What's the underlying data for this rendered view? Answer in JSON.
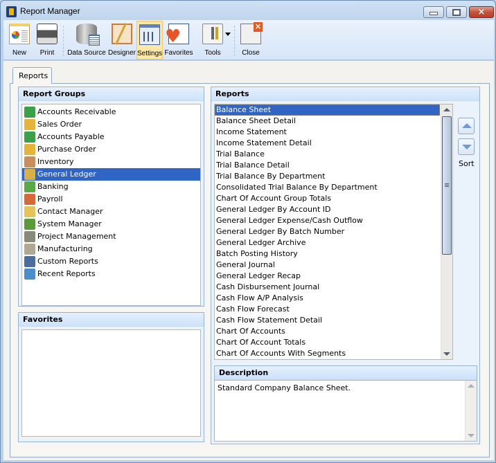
{
  "window": {
    "title": "Report Manager",
    "controls": {
      "minimize": "minimize",
      "maximize": "maximize",
      "close": "×"
    }
  },
  "toolbar": {
    "buttons": [
      {
        "id": "new",
        "label": "New",
        "icon": "new-report-icon"
      },
      {
        "id": "print",
        "label": "Print",
        "icon": "printer-icon"
      },
      {
        "id": "data-source",
        "label": "Data Source",
        "icon": "database-icon"
      },
      {
        "id": "designer",
        "label": "Designer",
        "icon": "designer-icon"
      },
      {
        "id": "settings",
        "label": "Settings",
        "icon": "settings-icon",
        "active": true
      },
      {
        "id": "favorites",
        "label": "Favorites",
        "icon": "favorites-heart-icon"
      },
      {
        "id": "tools",
        "label": "Tools",
        "icon": "tools-icon",
        "has_dropdown": true
      },
      {
        "id": "close",
        "label": "Close",
        "icon": "close-window-icon"
      }
    ]
  },
  "tabs": [
    {
      "label": "Reports",
      "active": true
    }
  ],
  "report_groups": {
    "title": "Report Groups",
    "items": [
      {
        "label": "Accounts Receivable",
        "icon": "accounts-receivable-icon",
        "color": "#3aa14a"
      },
      {
        "label": "Sales Order",
        "icon": "sales-order-icon",
        "color": "#e4b53a"
      },
      {
        "label": "Accounts Payable",
        "icon": "accounts-payable-icon",
        "color": "#3aa14a"
      },
      {
        "label": "Purchase Order",
        "icon": "purchase-order-icon",
        "color": "#e4b53a"
      },
      {
        "label": "Inventory",
        "icon": "inventory-icon",
        "color": "#c98e5c"
      },
      {
        "label": "General Ledger",
        "icon": "general-ledger-icon",
        "color": "#d8b04a",
        "selected": true
      },
      {
        "label": "Banking",
        "icon": "banking-icon",
        "color": "#5aa84a"
      },
      {
        "label": "Payroll",
        "icon": "payroll-icon",
        "color": "#d46a3a"
      },
      {
        "label": "Contact Manager",
        "icon": "contact-manager-icon",
        "color": "#e6c35a"
      },
      {
        "label": "System Manager",
        "icon": "system-manager-icon",
        "color": "#5a9a3a"
      },
      {
        "label": "Project Management",
        "icon": "project-management-icon",
        "color": "#8a8a7a"
      },
      {
        "label": "Manufacturing",
        "icon": "manufacturing-gear-icon",
        "color": "#b0a890"
      },
      {
        "label": "Custom Reports",
        "icon": "custom-reports-icon",
        "color": "#4b6d9e"
      },
      {
        "label": "Recent Reports",
        "icon": "recent-reports-icon",
        "color": "#4b8ec9"
      }
    ]
  },
  "favorites": {
    "title": "Favorites",
    "items": []
  },
  "reports": {
    "title": "Reports",
    "items": [
      "Balance Sheet",
      "Balance Sheet Detail",
      "Income Statement",
      "Income Statement Detail",
      "Trial Balance",
      "Trial Balance Detail",
      "Trial Balance By Department",
      "Consolidated Trial Balance By Department",
      "Chart Of Account Group Totals",
      "General Ledger By Account ID",
      "General Ledger Expense/Cash Outflow",
      "General Ledger By Batch Number",
      "General Ledger Archive",
      "Batch Posting History",
      "General Journal",
      "General Ledger Recap",
      "Cash Disbursement Journal",
      "Cash Flow A/P Analysis",
      "Cash Flow Forecast",
      "Cash Flow Statement Detail",
      "Chart Of Accounts",
      "Chart Of Account Totals",
      "Chart Of Accounts With Segments"
    ],
    "selected_index": 0,
    "scroll": {
      "thumb_start": 0.0,
      "thumb_fraction": 0.6
    }
  },
  "sort": {
    "label": "Sort",
    "up": "move-up",
    "down": "move-down"
  },
  "description": {
    "title": "Description",
    "text": "Standard Company Balance Sheet."
  },
  "colors": {
    "selection": "#3165c5",
    "active_toolbar": "#fde8a8",
    "group_header": "#cde2fa",
    "close_button": "#c4533c"
  }
}
